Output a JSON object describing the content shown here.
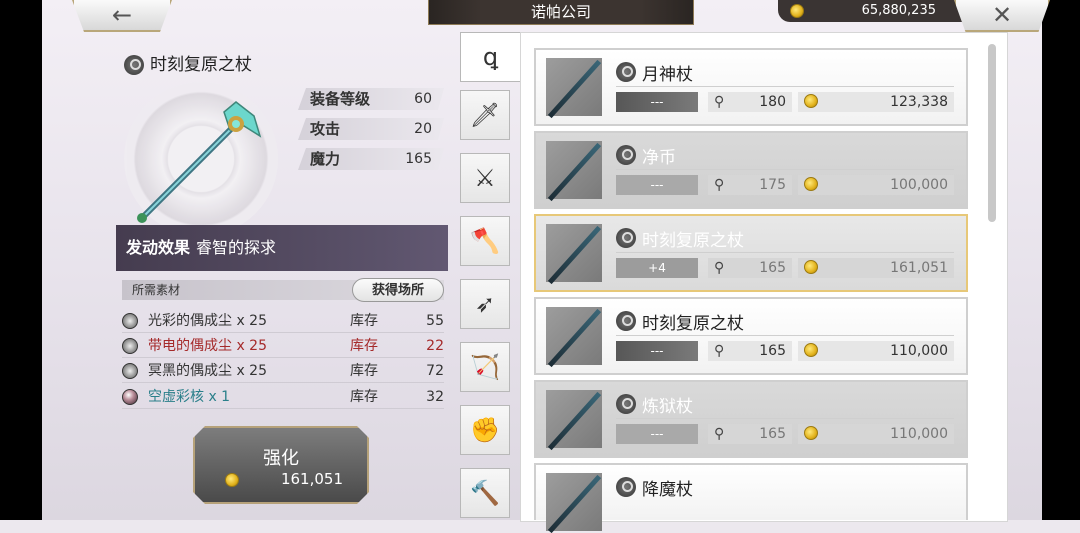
{
  "header": {
    "back_icon": "←",
    "title": "诺帕公司",
    "currency": "65,880,235",
    "close_icon": "✕"
  },
  "detail": {
    "name": "时刻复原之杖",
    "stats": [
      {
        "label": "装备等级",
        "value": "60"
      },
      {
        "label": "攻击",
        "value": "20"
      },
      {
        "label": "魔力",
        "value": "165"
      }
    ],
    "effect_label": "发动效果",
    "effect_value": "睿智的探求",
    "materials_label": "所需素材",
    "source_button": "获得场所",
    "materials": [
      {
        "name": "光彩的偶成尘 x 25",
        "stock_label": "库存",
        "qty": "55"
      },
      {
        "name": "带电的偶成尘 x 25",
        "stock_label": "库存",
        "qty": "22"
      },
      {
        "name": "冥黑的偶成尘 x 25",
        "stock_label": "库存",
        "qty": "72"
      },
      {
        "name": "空虚彩核 x 1",
        "stock_label": "库存",
        "qty": "32"
      }
    ],
    "enhance_label": "强化",
    "enhance_cost": "161,051"
  },
  "tabs": [
    {
      "name": "staff-tab",
      "icon": "staff-icon",
      "glyph": "ꝗ"
    },
    {
      "name": "sword-tab",
      "icon": "sword-icon",
      "glyph": "🗡"
    },
    {
      "name": "blade-tab",
      "icon": "blade-icon",
      "glyph": "⚔"
    },
    {
      "name": "axe-tab",
      "icon": "axe-icon",
      "glyph": "🪓"
    },
    {
      "name": "spear-tab",
      "icon": "spear-icon",
      "glyph": "➶"
    },
    {
      "name": "bow-tab",
      "icon": "bow-icon",
      "glyph": "🏹"
    },
    {
      "name": "fist-tab",
      "icon": "fist-icon",
      "glyph": "✊"
    },
    {
      "name": "hammer-tab",
      "icon": "hammer-icon",
      "glyph": "🔨"
    }
  ],
  "items": [
    {
      "name": "月神杖",
      "level": "---",
      "power": "180",
      "price": "123,338"
    },
    {
      "name": "净币",
      "level": "---",
      "power": "175",
      "price": "100,000"
    },
    {
      "name": "时刻复原之杖",
      "level": "+4",
      "power": "165",
      "price": "161,051"
    },
    {
      "name": "时刻复原之杖",
      "level": "---",
      "power": "165",
      "price": "110,000"
    },
    {
      "name": "炼狱杖",
      "level": "---",
      "power": "165",
      "price": "110,000"
    },
    {
      "name": "降魔杖",
      "level": "",
      "power": "",
      "price": ""
    }
  ]
}
